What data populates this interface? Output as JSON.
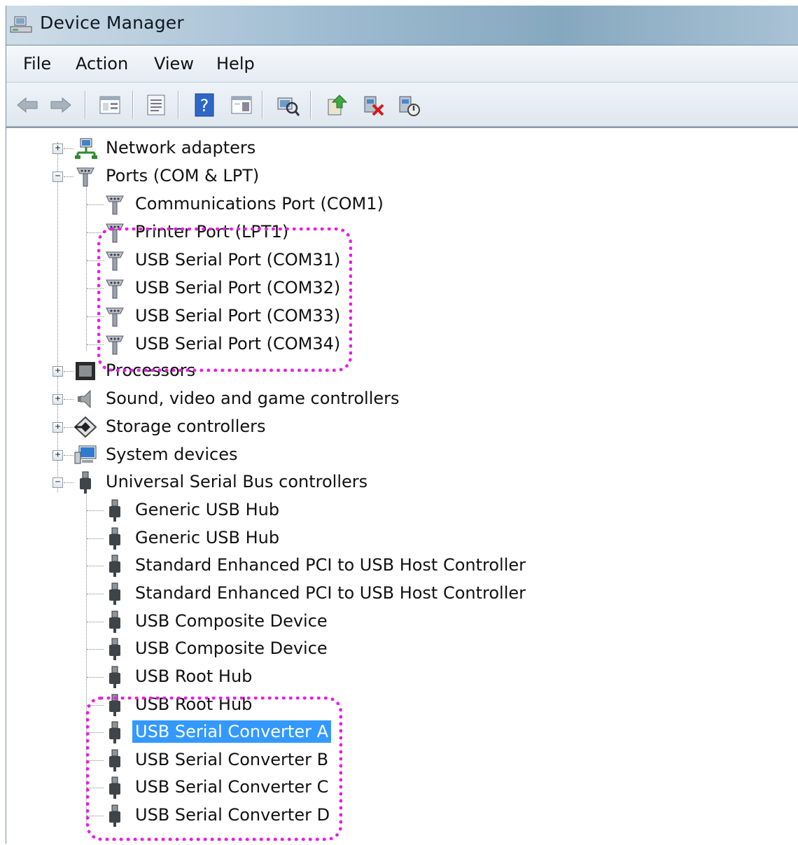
{
  "window": {
    "title": "Device Manager"
  },
  "menu": [
    {
      "label": "File"
    },
    {
      "label": "Action"
    },
    {
      "label": "View"
    },
    {
      "label": "Help"
    }
  ],
  "toolbar": {
    "buttons": [
      "back-icon",
      "forward-icon",
      "show-hide-tree-icon",
      "properties-icon",
      "help-icon",
      "action-pane-icon",
      "scan-hardware-icon",
      "update-driver-icon",
      "uninstall-icon",
      "disable-icon"
    ]
  },
  "tree": {
    "network_adapters": "Network adapters",
    "ports": "Ports (COM & LPT)",
    "ports_children": [
      "Communications Port (COM1)",
      "Printer Port (LPT1)",
      "USB Serial Port (COM31)",
      "USB Serial Port (COM32)",
      "USB Serial Port (COM33)",
      "USB Serial Port (COM34)"
    ],
    "processors": "Processors",
    "sound": "Sound, video and game controllers",
    "storage": "Storage controllers",
    "system": "System devices",
    "usb": "Universal Serial Bus controllers",
    "usb_children": [
      "Generic USB Hub",
      "Generic USB Hub",
      "Standard Enhanced PCI to USB Host Controller",
      "Standard Enhanced PCI to USB Host Controller",
      "USB Composite Device",
      "USB Composite Device",
      "USB Root Hub",
      "USB Root Hub",
      "USB Serial Converter A",
      "USB Serial Converter B",
      "USB Serial Converter C",
      "USB Serial Converter D"
    ],
    "selected": "USB Serial Converter A"
  },
  "colors": {
    "selection": "#3399ff",
    "annotation": "#e81ee3"
  }
}
